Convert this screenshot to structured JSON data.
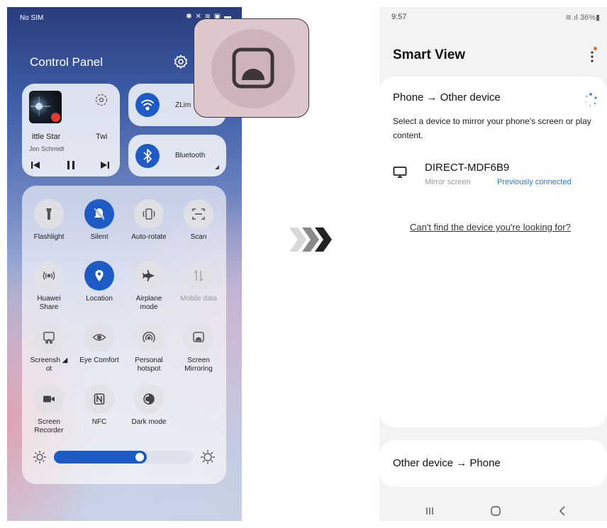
{
  "left_phone": {
    "status": {
      "carrier": "No SIM",
      "icons": "✱ ✕ ≋ ▣ ▬"
    },
    "panel_title": "Control Panel",
    "media": {
      "song_title": "ittle Star",
      "next_title": "Twi",
      "artist": "Jon Schmidt"
    },
    "wifi_tile": {
      "label": "ZLim"
    },
    "bluetooth_tile": {
      "label": "Bluetooth"
    },
    "tiles": [
      {
        "label": "Flashlight",
        "icon": "flashlight-icon",
        "active": false
      },
      {
        "label": "Silent",
        "icon": "bell-off-icon",
        "active": true
      },
      {
        "label": "Auto-rotate",
        "icon": "rotate-icon",
        "active": false
      },
      {
        "label": "Scan",
        "icon": "scan-icon",
        "active": false
      },
      {
        "label": "Huawei\nShare",
        "icon": "share-waves-icon",
        "active": false
      },
      {
        "label": "Location",
        "icon": "location-pin-icon",
        "active": true
      },
      {
        "label": "Airplane\nmode",
        "icon": "airplane-icon",
        "active": false
      },
      {
        "label": "Mobile data",
        "icon": "mobile-data-icon",
        "active": false,
        "disabled": true
      },
      {
        "label": "Screensh ◢\not",
        "icon": "screenshot-icon",
        "active": false
      },
      {
        "label": "Eye Comfort",
        "icon": "eye-icon",
        "active": false
      },
      {
        "label": "Personal\nhotspot",
        "icon": "hotspot-icon",
        "active": false
      },
      {
        "label": "Screen\nMirroring",
        "icon": "screen-mirroring-icon",
        "active": false
      },
      {
        "label": "Screen\nRecorder",
        "icon": "video-camera-icon",
        "active": false
      },
      {
        "label": "NFC",
        "icon": "nfc-icon",
        "active": false
      },
      {
        "label": "Dark mode",
        "icon": "dark-mode-icon",
        "active": false
      }
    ],
    "brightness_level": 0.67
  },
  "right_phone": {
    "status": {
      "time": "9:57",
      "right": "≋.ıl 36%▮"
    },
    "title": "Smart View",
    "section_title": "Phone → Other device",
    "description": "Select a device to mirror your phone's screen or play content.",
    "device": {
      "name": "DIRECT-MDF6B9",
      "subtitle": "Mirror screen",
      "status": "Previously connected"
    },
    "cant_find_link": "Can't find the device you're looking for?",
    "other_section_title": "Other device → Phone",
    "colors": {
      "accent": "#2f76c8",
      "notification_dot": "#f06b2a"
    }
  },
  "colors": {
    "primary_blue": "#1e5bc4"
  }
}
